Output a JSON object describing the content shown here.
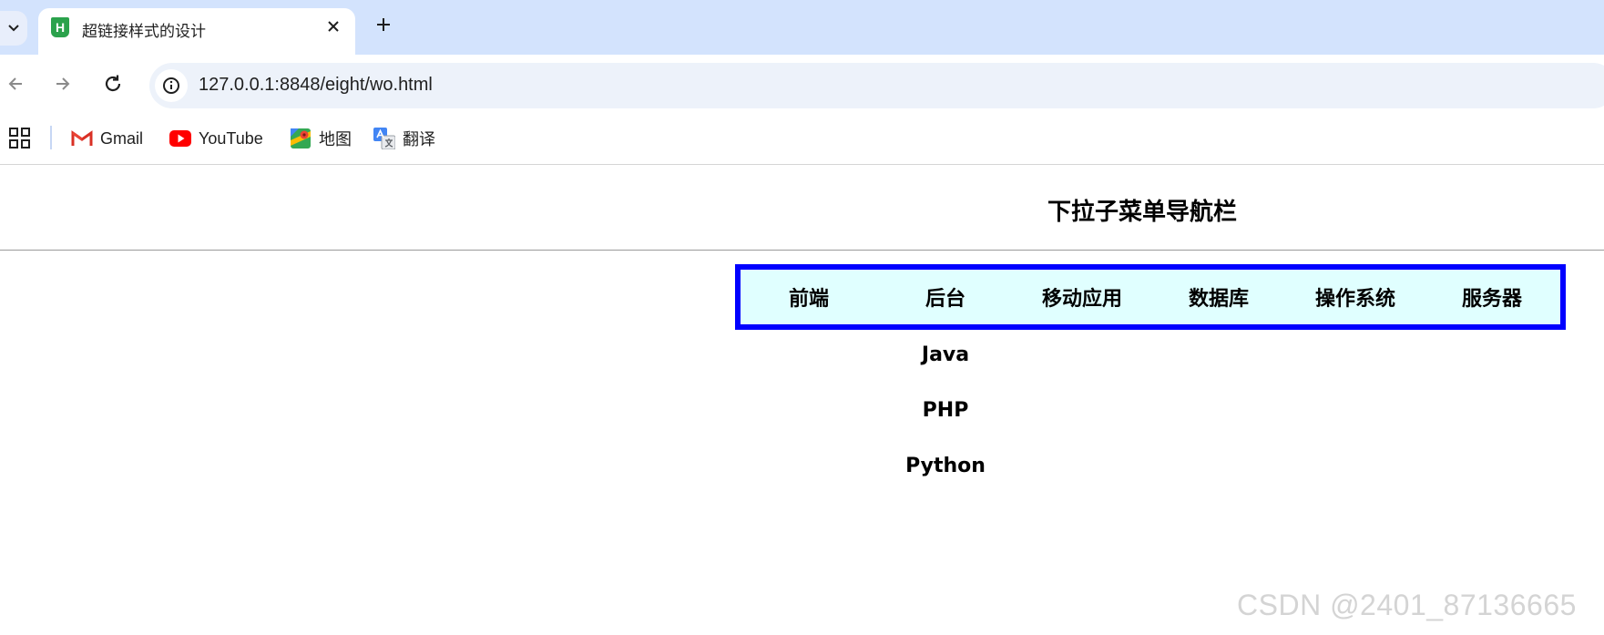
{
  "browser": {
    "tab": {
      "title": "超链接样式的设计",
      "favicon_letter": "H"
    },
    "address_bar": {
      "url": "127.0.0.1:8848/eight/wo.html"
    },
    "bookmarks": [
      {
        "label": "Gmail",
        "icon": "gmail-icon"
      },
      {
        "label": "YouTube",
        "icon": "youtube-icon"
      },
      {
        "label": "地图",
        "icon": "maps-icon"
      },
      {
        "label": "翻译",
        "icon": "translate-icon"
      }
    ]
  },
  "page": {
    "heading": "下拉子菜单导航栏",
    "nav": {
      "items": [
        "前端",
        "后台",
        "移动应用",
        "数据库",
        "操作系统",
        "服务器"
      ],
      "colors": {
        "border": "#0000ff",
        "background": "#e0ffff"
      }
    },
    "submenu": {
      "parent": "后台",
      "items": [
        "Java",
        "PHP",
        "Python"
      ]
    }
  },
  "watermark": "CSDN @2401_87136665"
}
